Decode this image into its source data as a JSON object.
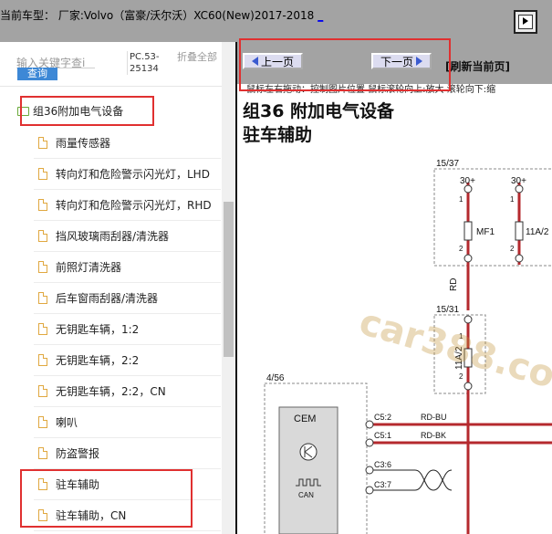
{
  "header": {
    "title": "当前车型：  厂家:Volvo（富豪/沃尔沃）XC60(New)2017-2018",
    "link": "_"
  },
  "search": {
    "placeholder": "输入关键字查i",
    "button": "查询",
    "code": "PC.53-25134",
    "collapse": "折叠全部"
  },
  "tree": {
    "root": "组36附加电气设备",
    "items": [
      "雨量传感器",
      "转向灯和危险警示闪光灯，LHD",
      "转向灯和危险警示闪光灯，RHD",
      "挡风玻璃雨刮器/清洗器",
      "前照灯清洗器",
      "后车窗雨刮器/清洗器",
      "无钥匙车辆，1:2",
      "无钥匙车辆，2:2",
      "无钥匙车辆，2:2，CN",
      "喇叭",
      "防盗警报",
      "驻车辅助",
      "驻车辅助，CN"
    ]
  },
  "nav": {
    "prev": "上一页",
    "next": "下一页",
    "refresh": "[刷新当前页]",
    "tip": "鼠标左右拖动：控制图片位置  鼠标滚轮向上:放大  滚轮向下:缩"
  },
  "diagram": {
    "title1": "组36 附加电气设备",
    "title2": "驻车辅助",
    "refs": [
      "15/37",
      "15/31",
      "4/56"
    ],
    "labels": {
      "p30a": "30+",
      "p30b": "30+",
      "mf1": "MF1",
      "f11a2a": "11A/2",
      "f11a2b": "11A/2",
      "rd": "RD",
      "cem": "CEM",
      "can": "CAN",
      "c52": "C5:2",
      "c51": "C5:1",
      "c36": "C3:6",
      "c37": "C3:7",
      "rdbu": "RD-BU",
      "rdbk": "RD-BK",
      "pin1a": "1",
      "pin2a": "2",
      "pin1b": "1",
      "pin2b": "2",
      "pin1c": "1",
      "pin2c": "2"
    },
    "watermark": "car388.com"
  },
  "colors": {
    "wire_red": "#b5292e",
    "highlight": "#e03030",
    "button_blue": "#3d88d6"
  }
}
